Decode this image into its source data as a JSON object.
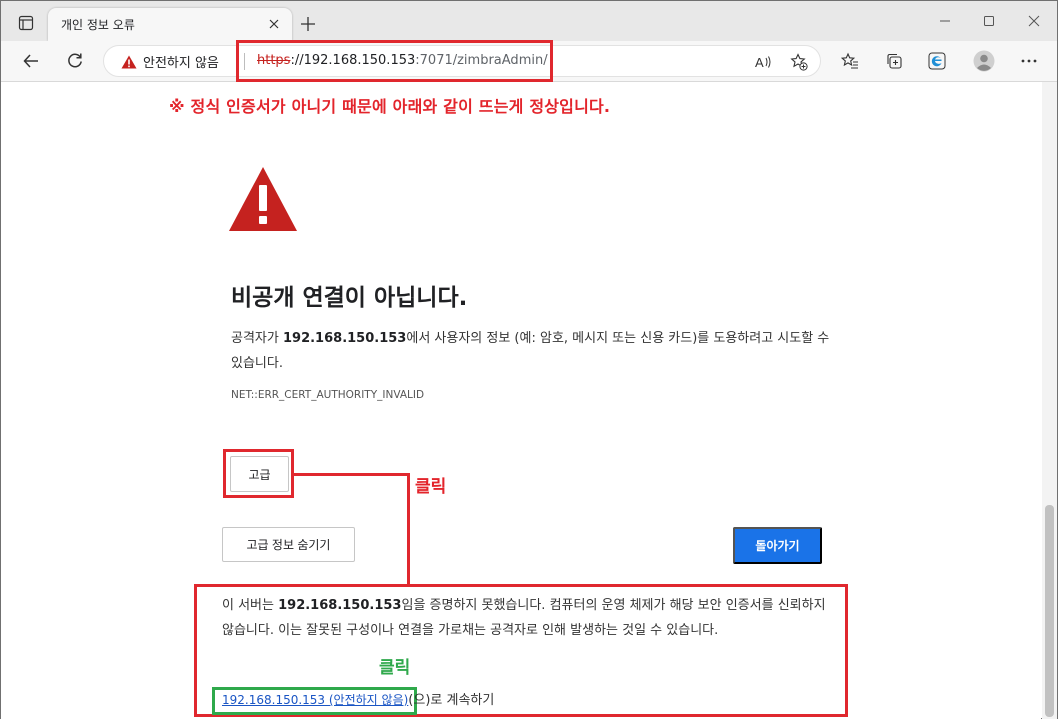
{
  "tab": {
    "title": "개인 정보 오류"
  },
  "address_bar": {
    "security_label": "안전하지 않음",
    "url_scheme": "https",
    "url_host": "://192.168.150.153",
    "url_rest": ":7071/zimbraAdmin/"
  },
  "annotations": {
    "notice": "※ 정식 인증서가 아니기 때문에 아래와 같이 뜨는게 정상입니다.",
    "click_red": "클릭",
    "click_green": "클릭"
  },
  "error_page": {
    "heading": "비공개 연결이 아닙니다.",
    "desc_prefix": "공격자가 ",
    "desc_host": "192.168.150.153",
    "desc_suffix": "에서 사용자의 정보 (예: 암호, 메시지 또는 신용 카드)를 도용하려고 시도할 수 있습니다.",
    "error_code": "NET::ERR_CERT_AUTHORITY_INVALID",
    "advanced_button": "고급",
    "hide_advanced_button": "고급 정보 숨기기",
    "back_button": "돌아가기",
    "detail_prefix": "이 서버는 ",
    "detail_host": "192.168.150.153",
    "detail_suffix": "임을 증명하지 못했습니다. 컴퓨터의 운영 체제가 해당 보안 인증서를 신뢰하지 않습니다. 이는 잘못된 구성이나 연결을 가로채는 공격자로 인해 발생하는 것일 수 있습니다.",
    "proceed_link": "192.168.150.153 (안전하지 않음)",
    "proceed_suffix": "(으)로 계속하기"
  },
  "colors": {
    "annotation_red": "#e0282e",
    "annotation_green": "#2fa94b",
    "primary_button": "#1a73e8",
    "warning_icon": "#c5221f"
  },
  "icons": [
    "tab-actions-icon",
    "close-icon",
    "plus-icon",
    "minimize-icon",
    "maximize-icon",
    "window-close-icon",
    "back-arrow-icon",
    "refresh-icon",
    "warning-icon",
    "read-aloud-icon",
    "add-favorite-icon",
    "favorites-icon",
    "collections-icon",
    "edge-icon",
    "profile-icon",
    "more-icon"
  ]
}
